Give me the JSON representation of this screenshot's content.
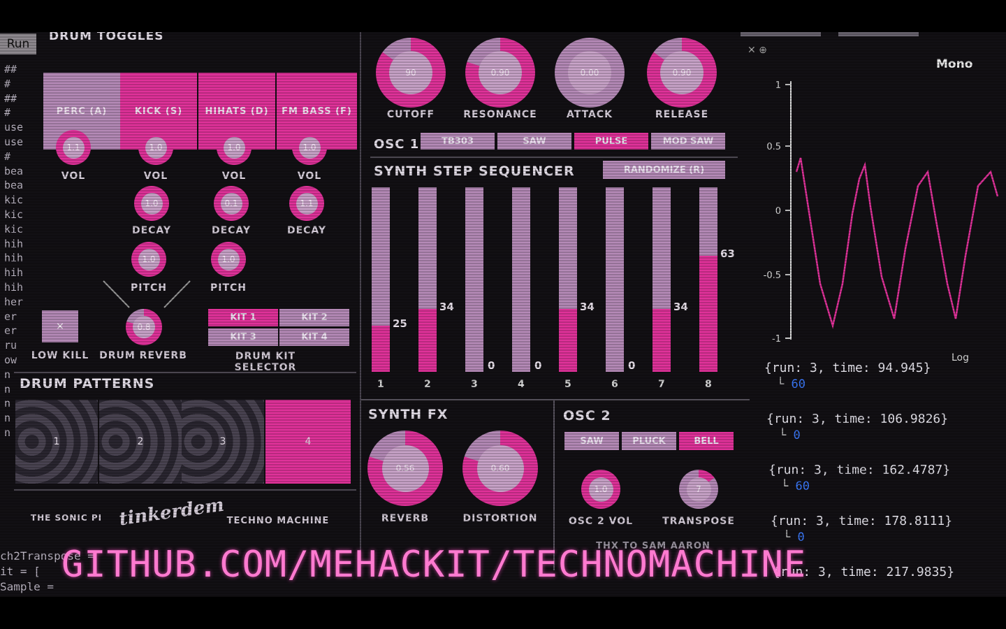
{
  "run_button": "Run",
  "drum_toggles": {
    "title": "DRUM TOGGLES",
    "buttons": [
      {
        "label": "PERC (A)",
        "active": false
      },
      {
        "label": "KICK (S)",
        "active": true
      },
      {
        "label": "HIHATS (D)",
        "active": true
      },
      {
        "label": "FM BASS (F)",
        "active": true
      }
    ],
    "vol_knobs": [
      "1.1",
      "1.0",
      "1.0",
      "1.0"
    ],
    "vol_label": "VOL",
    "decay_knobs": [
      "1.0",
      "0.1",
      "1.1"
    ],
    "decay_label": "DECAY",
    "pitch_knobs": [
      "1.0",
      "1.0"
    ],
    "pitch_label": "PITCH",
    "low_kill": {
      "label": "LOW KILL",
      "mark": "×"
    },
    "drum_reverb": {
      "label": "DRUM REVERB",
      "value": "0.8"
    },
    "kit_selector": {
      "label": "DRUM KIT SELECTOR",
      "kits": [
        "KIT 1",
        "KIT 2",
        "KIT 3",
        "KIT 4"
      ],
      "active": "KIT 1"
    }
  },
  "drum_patterns": {
    "title": "DRUM PATTERNS",
    "patterns": [
      "1",
      "2",
      "3",
      "4"
    ],
    "active": "4"
  },
  "footer_left": {
    "left": "THE SONIC PI",
    "logo": "tinkerdem",
    "right": "TECHNO MACHINE"
  },
  "synth_knobs": [
    {
      "label": "CUTOFF",
      "value": "90"
    },
    {
      "label": "RESONANCE",
      "value": "0.90"
    },
    {
      "label": "ATTACK",
      "value": "0.00"
    },
    {
      "label": "RELEASE",
      "value": "0.90"
    }
  ],
  "osc1": {
    "label": "OSC 1",
    "options": [
      "TB303",
      "SAW",
      "PULSE",
      "MOD SAW"
    ],
    "active": "PULSE"
  },
  "sequencer": {
    "title": "SYNTH STEP SEQUENCER",
    "randomize": "RANDOMIZE (R)",
    "steps": [
      {
        "num": "1",
        "value": 25
      },
      {
        "num": "2",
        "value": 34
      },
      {
        "num": "3",
        "value": 0
      },
      {
        "num": "4",
        "value": 0
      },
      {
        "num": "5",
        "value": 34
      },
      {
        "num": "6",
        "value": 0
      },
      {
        "num": "7",
        "value": 34
      },
      {
        "num": "8",
        "value": 63
      }
    ],
    "max": 100
  },
  "synth_fx": {
    "title": "SYNTH FX",
    "knobs": [
      {
        "label": "REVERB",
        "value": "0.56"
      },
      {
        "label": "DISTORTION",
        "value": "0.60"
      }
    ]
  },
  "osc2": {
    "title": "OSC 2",
    "options": [
      "SAW",
      "PLUCK",
      "BELL"
    ],
    "active": "BELL",
    "knobs": [
      {
        "label": "OSC 2 VOL",
        "value": "1.0"
      },
      {
        "label": "TRANSPOSE",
        "value": "7"
      }
    ]
  },
  "credit": "THX TO SAM AARON",
  "scope": {
    "icons": "✕ ⊕",
    "mode": "Mono",
    "y_ticks": [
      "1",
      "0.5",
      "0",
      "-0.5",
      "-1"
    ],
    "x_label": "Log",
    "color": "#e0329a"
  },
  "log_entries": [
    {
      "line": "{run: 3, time: 94.945}",
      "value": "60"
    },
    {
      "line": "{run: 3, time: 106.9826}",
      "value": "0"
    },
    {
      "line": "{run: 3, time: 162.4787}",
      "value": "60"
    },
    {
      "line": "{run: 3, time: 178.8111}",
      "value": "0"
    },
    {
      "line": "{run: 3, time: 217.9835}",
      "value": ""
    }
  ],
  "code_lines": [
    "##",
    "#",
    "##",
    "#",
    "use",
    "use",
    "#",
    "bea",
    "bea",
    "kic",
    "kic",
    "kic",
    "hih",
    "hih",
    "hih",
    "hih",
    "her",
    "er",
    "er",
    "ru",
    "ow",
    "n",
    "n",
    "n",
    "n",
    "n"
  ],
  "code_bottom": [
    "ch2Transpose =",
    "it = [",
    "Sample ="
  ],
  "overlay_url": "GITHUB.COM/MEHACKIT/TECHNOMACHINE",
  "colors": {
    "accent": "#e0329a",
    "lavender": "#b58ab7",
    "background": "#121014"
  }
}
